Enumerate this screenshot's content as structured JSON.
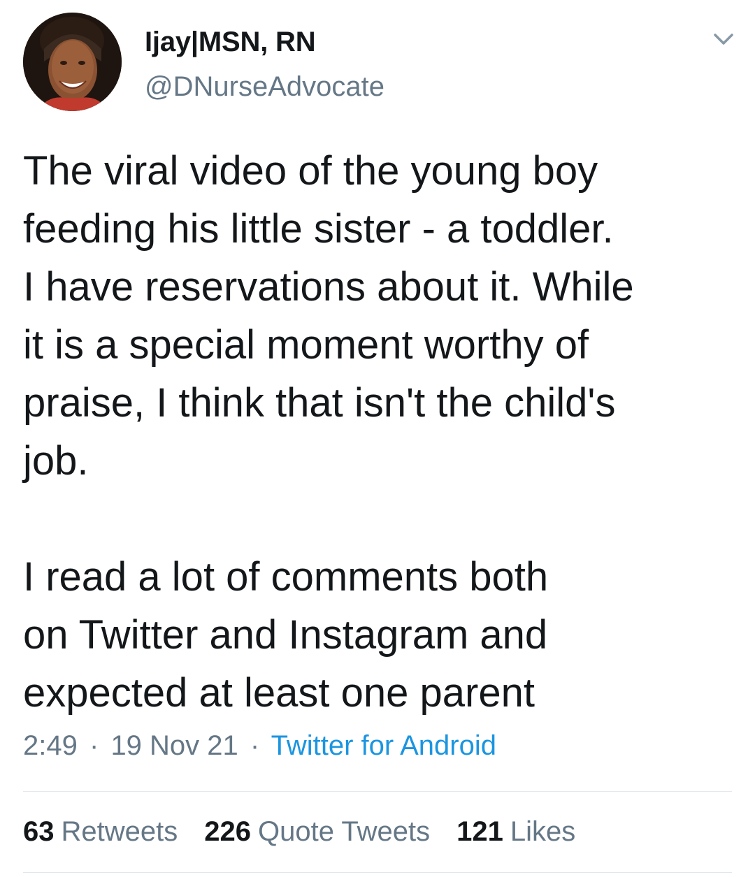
{
  "author": {
    "display_name": "Ijay|MSN, RN",
    "handle": "@DNurseAdvocate",
    "avatar_icon": "profile-photo"
  },
  "menu_icon": "chevron-down-icon",
  "tweet": {
    "paragraph_1": "The viral video of the young boy\nfeeding his little sister - a toddler.\nI have reservations about it. While\nit is a special moment worthy of\npraise, I think that isn't the child's\njob.",
    "paragraph_2": "I read a lot of comments both\non Twitter and Instagram and\nexpected at least one parent"
  },
  "meta": {
    "time": "2:49",
    "separator": "·",
    "date": "19 Nov 21",
    "source": "Twitter for Android"
  },
  "stats": {
    "retweets_count": "63",
    "retweets_label": "Retweets",
    "quote_count": "226",
    "quote_label": "Quote Tweets",
    "likes_count": "121",
    "likes_label": "Likes"
  },
  "colors": {
    "text": "#14171a",
    "secondary": "#657786",
    "link": "#1b95e0",
    "divider": "#e1e8ed"
  }
}
